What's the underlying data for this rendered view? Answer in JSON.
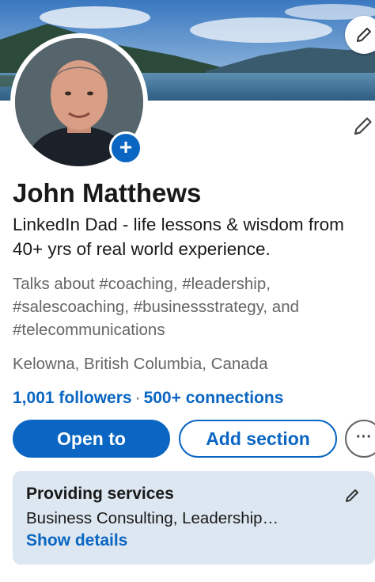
{
  "profile": {
    "name": "John Matthews",
    "headline": "LinkedIn Dad - life lessons & wisdom from 40+ yrs of real world experience.",
    "talks_about": "Talks about #coaching, #leadership, #salescoaching, #businessstrategy, and #telecommunications",
    "location": "Kelowna, British Columbia, Canada",
    "followers": "1,001 followers",
    "separator": "·",
    "connections": "500+ connections"
  },
  "actions": {
    "open_to": "Open to",
    "add_section": "Add section",
    "more": "···"
  },
  "services": {
    "title": "Providing services",
    "description": "Business Consulting, Leadership…",
    "link": "Show details"
  },
  "icons": {
    "banner_edit": "pencil-icon",
    "profile_edit": "pencil-icon",
    "add_photo": "plus-icon",
    "services_edit": "pencil-icon"
  },
  "colors": {
    "brand_blue": "#0a66c2",
    "services_bg": "#dde7f1",
    "secondary_text": "#666666"
  }
}
